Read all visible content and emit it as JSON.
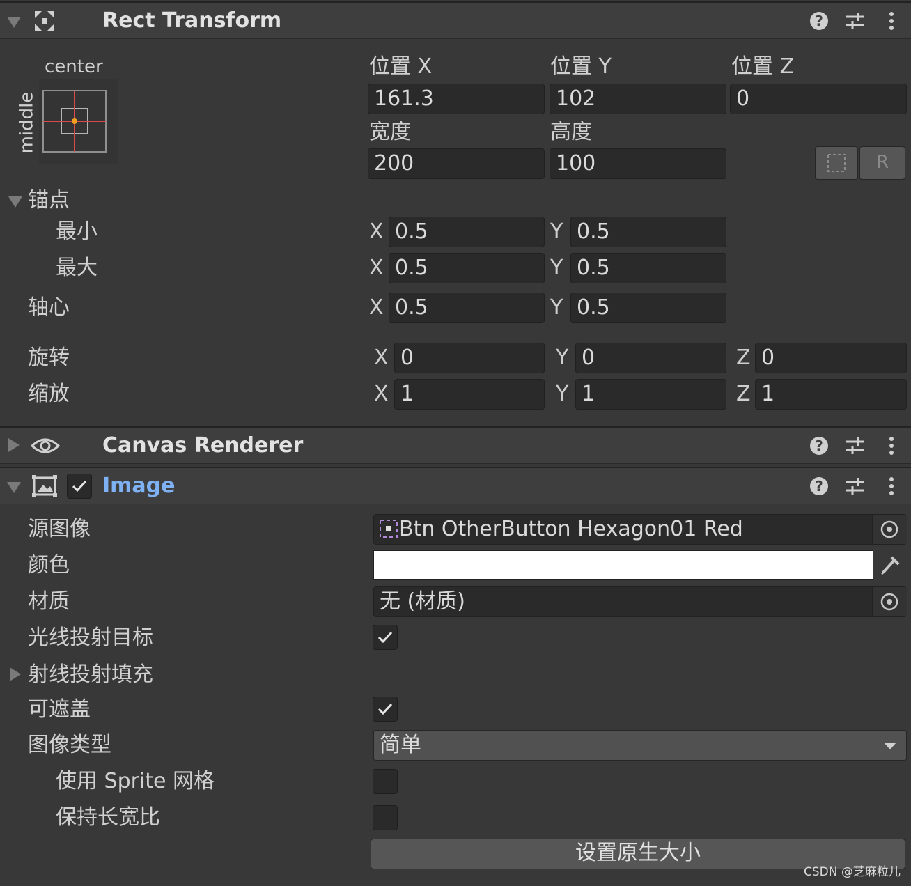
{
  "rect_transform": {
    "title": "Rect Transform",
    "anchor_preset": {
      "horizontal": "center",
      "vertical": "middle"
    },
    "position_headers": [
      "位置 X",
      "位置 Y",
      "位置 Z"
    ],
    "pos_x": "161.3",
    "pos_y": "102",
    "pos_z": "0",
    "width_label": "宽度",
    "height_label": "高度",
    "width": "200",
    "height": "100",
    "raw_button": "R",
    "anchors_label": "锚点",
    "min_label": "最小",
    "max_label": "最大",
    "pivot_label": "轴心",
    "rotation_label": "旋转",
    "scale_label": "缩放",
    "axes": {
      "x": "X",
      "y": "Y",
      "z": "Z"
    },
    "anchor_min": {
      "x": "0.5",
      "y": "0.5"
    },
    "anchor_max": {
      "x": "0.5",
      "y": "0.5"
    },
    "pivot": {
      "x": "0.5",
      "y": "0.5"
    },
    "rotation": {
      "x": "0",
      "y": "0",
      "z": "0"
    },
    "scale": {
      "x": "1",
      "y": "1",
      "z": "1"
    }
  },
  "canvas_renderer": {
    "title": "Canvas Renderer"
  },
  "image": {
    "title": "Image",
    "enabled": true,
    "source_image_label": "源图像",
    "source_image_value": "Btn OtherButton Hexagon01 Red",
    "color_label": "颜色",
    "color_value": "#ffffff",
    "material_label": "材质",
    "material_value": "无 (材质)",
    "raycast_target_label": "光线投射目标",
    "raycast_target": true,
    "raycast_padding_label": "射线投射填充",
    "maskable_label": "可遮盖",
    "maskable": true,
    "image_type_label": "图像类型",
    "image_type_value": "简单",
    "use_sprite_mesh_label": "使用 Sprite 网格",
    "use_sprite_mesh": false,
    "preserve_aspect_label": "保持长宽比",
    "preserve_aspect": false,
    "set_native_size_button": "设置原生大小"
  },
  "watermark": "CSDN @芝麻粒儿",
  "colors": {
    "panel_bg": "#383838",
    "header_bg": "#3e3e3e",
    "field_bg": "#2a2a2a",
    "accent_blue": "#7fb1f5",
    "anchor_red": "#d94b4b",
    "pivot_orange": "#f0a020"
  }
}
